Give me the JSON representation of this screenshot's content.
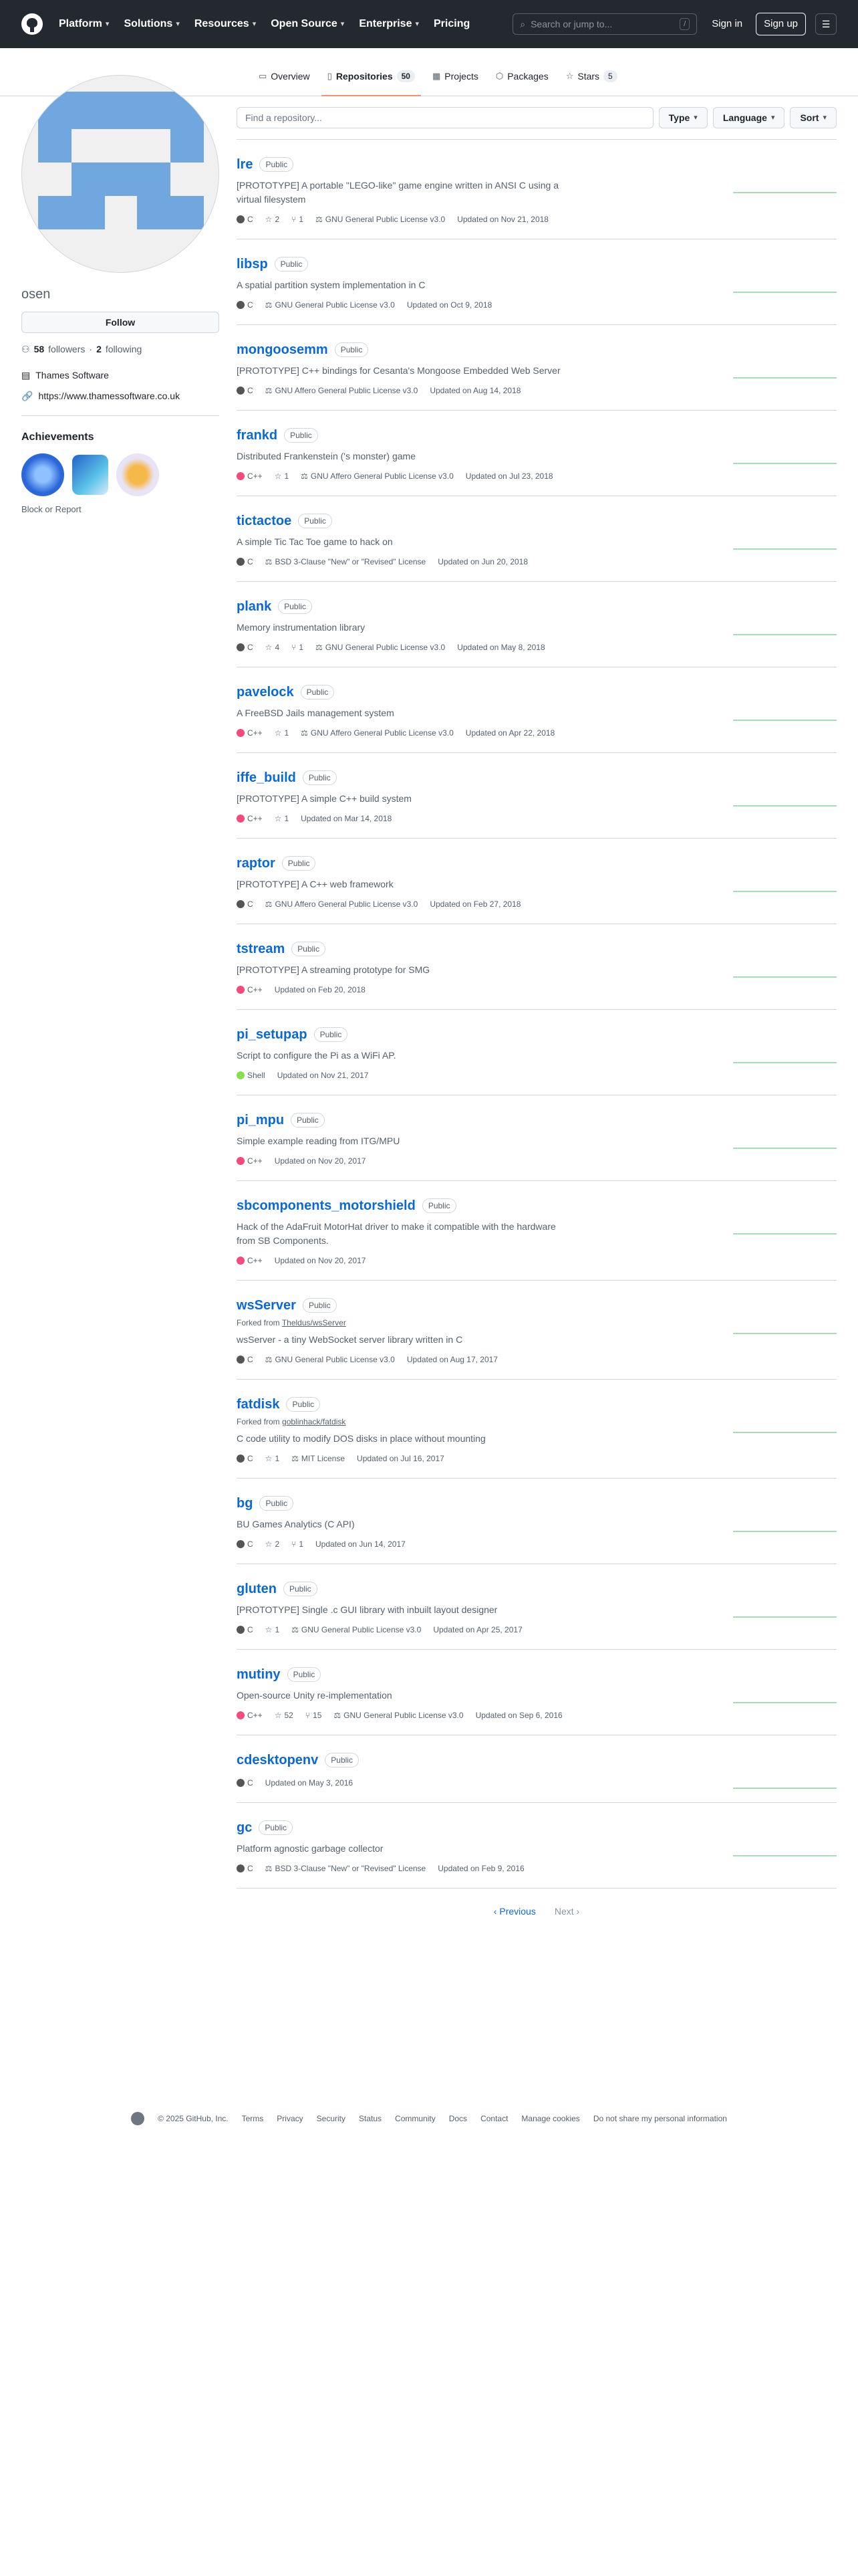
{
  "header": {
    "nav": [
      "Platform",
      "Solutions",
      "Resources",
      "Open Source",
      "Enterprise",
      "Pricing"
    ],
    "search_placeholder": "Search or jump to...",
    "search_key": "/",
    "signin": "Sign in",
    "signup": "Sign up"
  },
  "tabs": [
    {
      "label": "Overview"
    },
    {
      "label": "Repositories",
      "count": "50"
    },
    {
      "label": "Projects"
    },
    {
      "label": "Packages"
    },
    {
      "label": "Stars",
      "count": "5"
    }
  ],
  "profile": {
    "username": "osen",
    "follow": "Follow",
    "followers": "58",
    "followers_label": "followers",
    "following": "2",
    "following_label": "following",
    "company": "Thames Software",
    "website": "https://www.thamessoftware.co.uk",
    "achievements": "Achievements",
    "block": "Block or Report"
  },
  "filters": {
    "placeholder": "Find a repository...",
    "type": "Type",
    "language": "Language",
    "sort": "Sort"
  },
  "languages": {
    "C": "#555555",
    "C++": "#f34b7d",
    "Shell": "#89e051"
  },
  "repos": [
    {
      "name": "lre",
      "vis": "Public",
      "desc": "[PROTOTYPE] A portable \"LEGO-like\" game engine written in ANSI C using a virtual filesystem",
      "lang": "C",
      "stars": "2",
      "forks": "1",
      "license": "GNU General Public License v3.0",
      "updated": "Updated on Nov 21, 2018"
    },
    {
      "name": "libsp",
      "vis": "Public",
      "desc": "A spatial partition system implementation in C",
      "lang": "C",
      "license": "GNU General Public License v3.0",
      "updated": "Updated on Oct 9, 2018"
    },
    {
      "name": "mongoosemm",
      "vis": "Public",
      "desc": "[PROTOTYPE] C++ bindings for Cesanta's Mongoose Embedded Web Server",
      "lang": "C",
      "license": "GNU Affero General Public License v3.0",
      "updated": "Updated on Aug 14, 2018"
    },
    {
      "name": "frankd",
      "vis": "Public",
      "desc": "Distributed Frankenstein ('s monster) game",
      "lang": "C++",
      "stars": "1",
      "license": "GNU Affero General Public License v3.0",
      "updated": "Updated on Jul 23, 2018"
    },
    {
      "name": "tictactoe",
      "vis": "Public",
      "desc": "A simple Tic Tac Toe game to hack on",
      "lang": "C",
      "license": "BSD 3-Clause \"New\" or \"Revised\" License",
      "updated": "Updated on Jun 20, 2018"
    },
    {
      "name": "plank",
      "vis": "Public",
      "desc": "Memory instrumentation library",
      "lang": "C",
      "stars": "4",
      "forks": "1",
      "license": "GNU General Public License v3.0",
      "updated": "Updated on May 8, 2018"
    },
    {
      "name": "pavelock",
      "vis": "Public",
      "desc": "A FreeBSD Jails management system",
      "lang": "C++",
      "stars": "1",
      "license": "GNU Affero General Public License v3.0",
      "updated": "Updated on Apr 22, 2018"
    },
    {
      "name": "iffe_build",
      "vis": "Public",
      "desc": "[PROTOTYPE] A simple C++ build system",
      "lang": "C++",
      "stars": "1",
      "updated": "Updated on Mar 14, 2018"
    },
    {
      "name": "raptor",
      "vis": "Public",
      "desc": "[PROTOTYPE] A C++ web framework",
      "lang": "C",
      "license": "GNU Affero General Public License v3.0",
      "updated": "Updated on Feb 27, 2018"
    },
    {
      "name": "tstream",
      "vis": "Public",
      "desc": "[PROTOTYPE] A streaming prototype for SMG",
      "lang": "C++",
      "updated": "Updated on Feb 20, 2018"
    },
    {
      "name": "pi_setupap",
      "vis": "Public",
      "desc": "Script to configure the Pi as a WiFi AP.",
      "lang": "Shell",
      "updated": "Updated on Nov 21, 2017"
    },
    {
      "name": "pi_mpu",
      "vis": "Public",
      "desc": "Simple example reading from ITG/MPU",
      "lang": "C++",
      "updated": "Updated on Nov 20, 2017"
    },
    {
      "name": "sbcomponents_motorshield",
      "vis": "Public",
      "desc": "Hack of the AdaFruit MotorHat driver to make it compatible with the hardware from SB Components.",
      "lang": "C++",
      "updated": "Updated on Nov 20, 2017"
    },
    {
      "name": "wsServer",
      "vis": "Public",
      "fork_prefix": "Forked from",
      "fork": "Theldus/wsServer",
      "desc": "wsServer - a tiny WebSocket server library written in C",
      "lang": "C",
      "license": "GNU General Public License v3.0",
      "updated": "Updated on Aug 17, 2017"
    },
    {
      "name": "fatdisk",
      "vis": "Public",
      "fork_prefix": "Forked from",
      "fork": "goblinhack/fatdisk",
      "desc": "C code utility to modify DOS disks in place without mounting",
      "lang": "C",
      "stars": "1",
      "license": "MIT License",
      "updated": "Updated on Jul 16, 2017"
    },
    {
      "name": "bg",
      "vis": "Public",
      "desc": "BU Games Analytics (C API)",
      "lang": "C",
      "stars": "2",
      "forks": "1",
      "updated": "Updated on Jun 14, 2017"
    },
    {
      "name": "gluten",
      "vis": "Public",
      "desc": "[PROTOTYPE] Single .c GUI library with inbuilt layout designer",
      "lang": "C",
      "stars": "1",
      "license": "GNU General Public License v3.0",
      "updated": "Updated on Apr 25, 2017"
    },
    {
      "name": "mutiny",
      "vis": "Public",
      "desc": "Open-source Unity re-implementation",
      "lang": "C++",
      "stars": "52",
      "forks": "15",
      "license": "GNU General Public License v3.0",
      "updated": "Updated on Sep 6, 2016"
    },
    {
      "name": "cdesktopenv",
      "vis": "Public",
      "lang": "C",
      "updated": "Updated on May 3, 2016"
    },
    {
      "name": "gc",
      "vis": "Public",
      "desc": "Platform agnostic garbage collector",
      "lang": "C",
      "license": "BSD 3-Clause \"New\" or \"Revised\" License",
      "updated": "Updated on Feb 9, 2016"
    }
  ],
  "pager": {
    "prev": "Previous",
    "next": "Next"
  },
  "footer": [
    "© 2025 GitHub, Inc.",
    "Terms",
    "Privacy",
    "Security",
    "Status",
    "Community",
    "Docs",
    "Contact",
    "Manage cookies",
    "Do not share my personal information"
  ]
}
